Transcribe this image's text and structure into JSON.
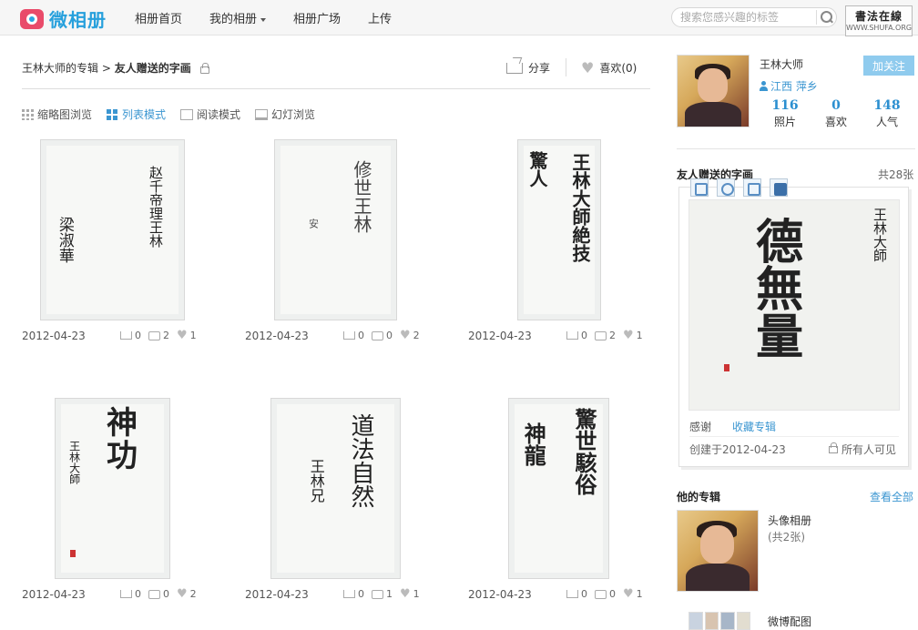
{
  "brand": {
    "name": "微相册",
    "colors": {
      "accent": "#27a0dc",
      "logo": "#e94b6a",
      "link": "#3b96d1"
    }
  },
  "nav": {
    "home": "相册首页",
    "mine": "我的相册",
    "square": "相册广场",
    "upload": "上传"
  },
  "search": {
    "placeholder": "搜索您感兴趣的标签",
    "icon": "search-icon"
  },
  "partner": {
    "title": "書法在線",
    "url": "WWW.SHUFA.ORG"
  },
  "breadcrumb": {
    "owner": "王林大师的专辑",
    "sep": ">",
    "album": "友人赠送的字画"
  },
  "actions": {
    "share": "分享",
    "like": "喜欢(0)"
  },
  "modes": [
    {
      "label": "缩略图浏览",
      "icon": "grid-icon"
    },
    {
      "label": "列表模式",
      "icon": "list-icon",
      "active": true
    },
    {
      "label": "阅读模式",
      "icon": "read-icon"
    },
    {
      "label": "幻灯浏览",
      "icon": "slideshow-icon"
    }
  ],
  "photos": [
    {
      "date": "2012-04-23",
      "shares": "0",
      "comments": "2",
      "likes": "1",
      "text": "赵千帝理王林",
      "sig": "梁淑華"
    },
    {
      "date": "2012-04-23",
      "shares": "0",
      "comments": "0",
      "likes": "2",
      "text": "修世王林",
      "sig": "安"
    },
    {
      "date": "2012-04-23",
      "shares": "0",
      "comments": "2",
      "likes": "1",
      "text": "王林大師絶技",
      "sig": "驚人"
    },
    {
      "date": "2012-04-23",
      "shares": "0",
      "comments": "0",
      "likes": "2",
      "text": "神功",
      "sig": "王林大師"
    },
    {
      "date": "2012-04-23",
      "shares": "0",
      "comments": "1",
      "likes": "1",
      "text": "道法自然",
      "sig": "王林兄"
    },
    {
      "date": "2012-04-23",
      "shares": "0",
      "comments": "0",
      "likes": "1",
      "text": "驚世駭俗",
      "sig": "神龍"
    }
  ],
  "user": {
    "name": "王林大师",
    "location": "江西 萍乡",
    "follow": "加关注",
    "stats": [
      {
        "n": "116",
        "l": "照片"
      },
      {
        "n": "0",
        "l": "喜欢"
      },
      {
        "n": "148",
        "l": "人气"
      }
    ]
  },
  "album": {
    "title": "友人赠送的字画",
    "count": "共28张",
    "thanks": "感谢",
    "collect": "收藏专辑",
    "created": "创建于2012-04-23",
    "visibility": "所有人可见",
    "preview_text": "德無量",
    "preview_sig": "王林大師"
  },
  "his": {
    "title": "他的专辑",
    "all": "查看全部",
    "albums": [
      {
        "name": "头像相册",
        "count": "(共2张)"
      },
      {
        "name": "微博配图"
      }
    ]
  }
}
